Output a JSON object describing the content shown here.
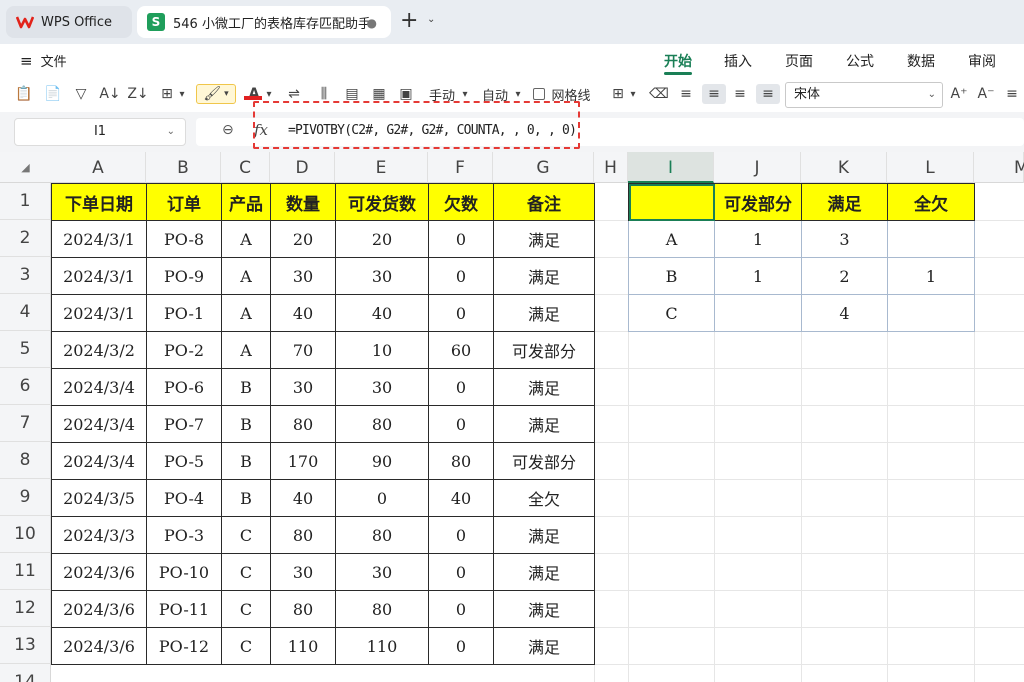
{
  "tabs": {
    "app_label": "WPS Office",
    "doc_label": "546 小微工厂的表格库存匹配助手",
    "doc_status": "●",
    "new_tab": "+",
    "new_tab_arrow": "⌄"
  },
  "menu": {
    "file_icon": "≡",
    "file_label": "文件",
    "ribbon_tabs": [
      "开始",
      "插入",
      "页面",
      "公式",
      "数据",
      "审阅"
    ],
    "active_tab": "开始"
  },
  "toolbar": {
    "manual_label": "手动",
    "auto_label": "自动",
    "gridlines_label": "网格线",
    "font_name": "宋体",
    "font_color_letter": "A",
    "grow_font": "A⁺",
    "shrink_font": "A⁻"
  },
  "formula_bar": {
    "name_box": "I1",
    "fx": "fx",
    "formula": "=PIVOTBY(C2#, G2#, G2#, COUNTA, , 0, , 0)"
  },
  "columns": [
    "A",
    "B",
    "C",
    "D",
    "E",
    "F",
    "G",
    "H",
    "I",
    "J",
    "K",
    "L",
    "M"
  ],
  "selected_column": "I",
  "rows": [
    "1",
    "2",
    "3",
    "4",
    "5",
    "6",
    "7",
    "8",
    "9",
    "10",
    "11",
    "12",
    "13",
    "14"
  ],
  "sheet": {
    "headers": [
      "下单日期",
      "订单",
      "产品",
      "数量",
      "可发货数",
      "欠数",
      "备注"
    ],
    "data": [
      [
        "2024/3/1",
        "PO-8",
        "A",
        "20",
        "20",
        "0",
        "满足"
      ],
      [
        "2024/3/1",
        "PO-9",
        "A",
        "30",
        "30",
        "0",
        "满足"
      ],
      [
        "2024/3/1",
        "PO-1",
        "A",
        "40",
        "40",
        "0",
        "满足"
      ],
      [
        "2024/3/2",
        "PO-2",
        "A",
        "70",
        "10",
        "60",
        "可发部分"
      ],
      [
        "2024/3/4",
        "PO-6",
        "B",
        "30",
        "30",
        "0",
        "满足"
      ],
      [
        "2024/3/4",
        "PO-7",
        "B",
        "80",
        "80",
        "0",
        "满足"
      ],
      [
        "2024/3/4",
        "PO-5",
        "B",
        "170",
        "90",
        "80",
        "可发部分"
      ],
      [
        "2024/3/5",
        "PO-4",
        "B",
        "40",
        "0",
        "40",
        "全欠"
      ],
      [
        "2024/3/3",
        "PO-3",
        "C",
        "80",
        "80",
        "0",
        "满足"
      ],
      [
        "2024/3/6",
        "PO-10",
        "C",
        "30",
        "30",
        "0",
        "满足"
      ],
      [
        "2024/3/6",
        "PO-11",
        "C",
        "80",
        "80",
        "0",
        "满足"
      ],
      [
        "2024/3/6",
        "PO-12",
        "C",
        "110",
        "110",
        "0",
        "满足"
      ]
    ]
  },
  "pivot": {
    "headers": [
      "",
      "可发部分",
      "满足",
      "全欠"
    ],
    "data": [
      [
        "A",
        "1",
        "3",
        ""
      ],
      [
        "B",
        "1",
        "2",
        "1"
      ],
      [
        "C",
        "",
        "4",
        ""
      ]
    ]
  },
  "colors": {
    "accent": "#1a7f56",
    "header_fill": "#ffff00",
    "highlight_box": "#e53935"
  }
}
